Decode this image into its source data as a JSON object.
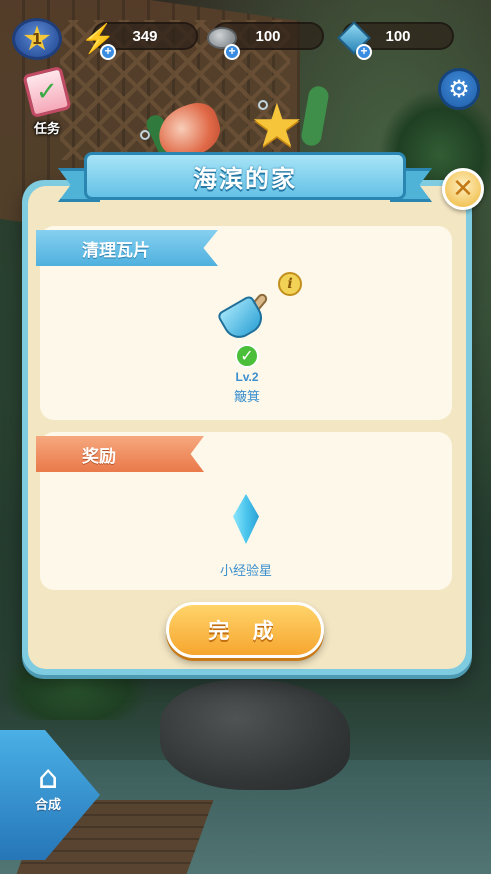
{
  "hud": {
    "level": "1",
    "energy": "349",
    "stone": "100",
    "gems": "100"
  },
  "tasks": {
    "label": "任务"
  },
  "modal": {
    "title": "海滨的家",
    "clear_section": {
      "tag": "清理瓦片",
      "tool_level": "Lv.2",
      "tool_name": "簸箕"
    },
    "reward_section": {
      "tag": "奖励",
      "reward_name": "小经验星"
    },
    "done_label": "完 成"
  },
  "merge": {
    "label": "合成"
  },
  "icons": {
    "level": "star-icon",
    "energy": "lightning-bolt-icon",
    "stone": "stone-icon",
    "gems": "gem-icon",
    "settings": "gear-icon",
    "close": "close-icon",
    "info": "info-icon",
    "tool": "dustpan-icon",
    "reward": "crystal-icon",
    "merge": "house-icon"
  },
  "colors": {
    "modal_frame": "#7fcbe0",
    "modal_bg": "#f3e6c3",
    "tag_blue": "#4fb0de",
    "tag_orange": "#e9794a",
    "done_button": "#f6a62f",
    "text_blue": "#3b8fcf"
  }
}
